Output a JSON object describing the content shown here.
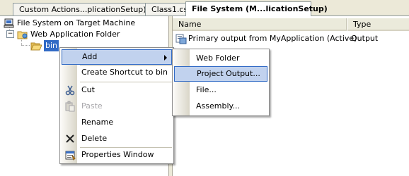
{
  "tabs": [
    {
      "label": "Custom Actions...plicationSetup)",
      "active": false
    },
    {
      "label": "Class1.cs",
      "active": false
    },
    {
      "label": "File System (M...licationSetup)",
      "active": true
    }
  ],
  "tree": {
    "root_label": "File System on Target Machine",
    "folder_label": "Web Application Folder",
    "bin_label": "bin"
  },
  "list": {
    "columns": [
      "Name",
      "Type"
    ],
    "rows": [
      {
        "name": "Primary output from MyApplication (Active)",
        "type": "Output"
      }
    ]
  },
  "context_menu": {
    "items": [
      {
        "label": "Add",
        "icon": null,
        "highlighted": true,
        "submenu": true
      },
      {
        "label": "Create Shortcut to bin",
        "icon": null
      },
      {
        "label": "Cut",
        "icon": "scissors-icon"
      },
      {
        "label": "Paste",
        "icon": "paste-icon",
        "disabled": true
      },
      {
        "label": "Rename",
        "icon": null
      },
      {
        "label": "Delete",
        "icon": "delete-x-icon"
      },
      {
        "label": "Properties Window",
        "icon": "properties-icon"
      }
    ]
  },
  "submenu": {
    "items": [
      {
        "label": "Web Folder"
      },
      {
        "label": "Project Output...",
        "highlighted": true
      },
      {
        "label": "File..."
      },
      {
        "label": "Assembly..."
      }
    ]
  },
  "colors": {
    "selection": "#316ac5",
    "menu_highlight": "#c1d2ee",
    "background": "#ece9d8"
  }
}
